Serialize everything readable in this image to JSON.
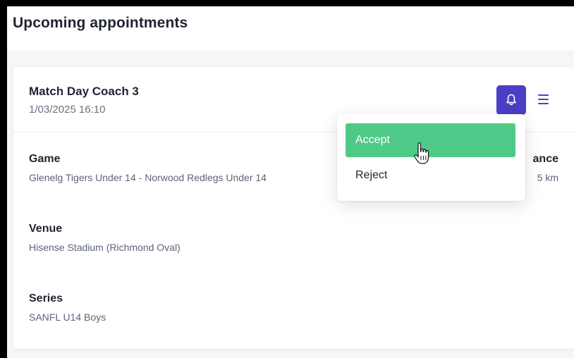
{
  "page": {
    "title": "Upcoming appointments"
  },
  "appointment": {
    "title": "Match Day Coach 3",
    "datetime": "1/03/2025 16:10",
    "notify_icon": "bell-icon",
    "menu_icon": "hamburger-menu-icon",
    "fields": {
      "game": {
        "label": "Game",
        "value": "Glenelg Tigers Under 14 - Norwood Redlegs Under 14"
      },
      "distance": {
        "label": "ance",
        "value": "5 km"
      },
      "venue": {
        "label": "Venue",
        "value": "Hisense Stadium (Richmond Oval)"
      },
      "series": {
        "label": "Series",
        "value": "SANFL U14 Boys"
      }
    }
  },
  "dropdown": {
    "accept_label": "Accept",
    "reject_label": "Reject"
  },
  "colors": {
    "accent": "#4b3fc6",
    "accept": "#4fc987"
  }
}
